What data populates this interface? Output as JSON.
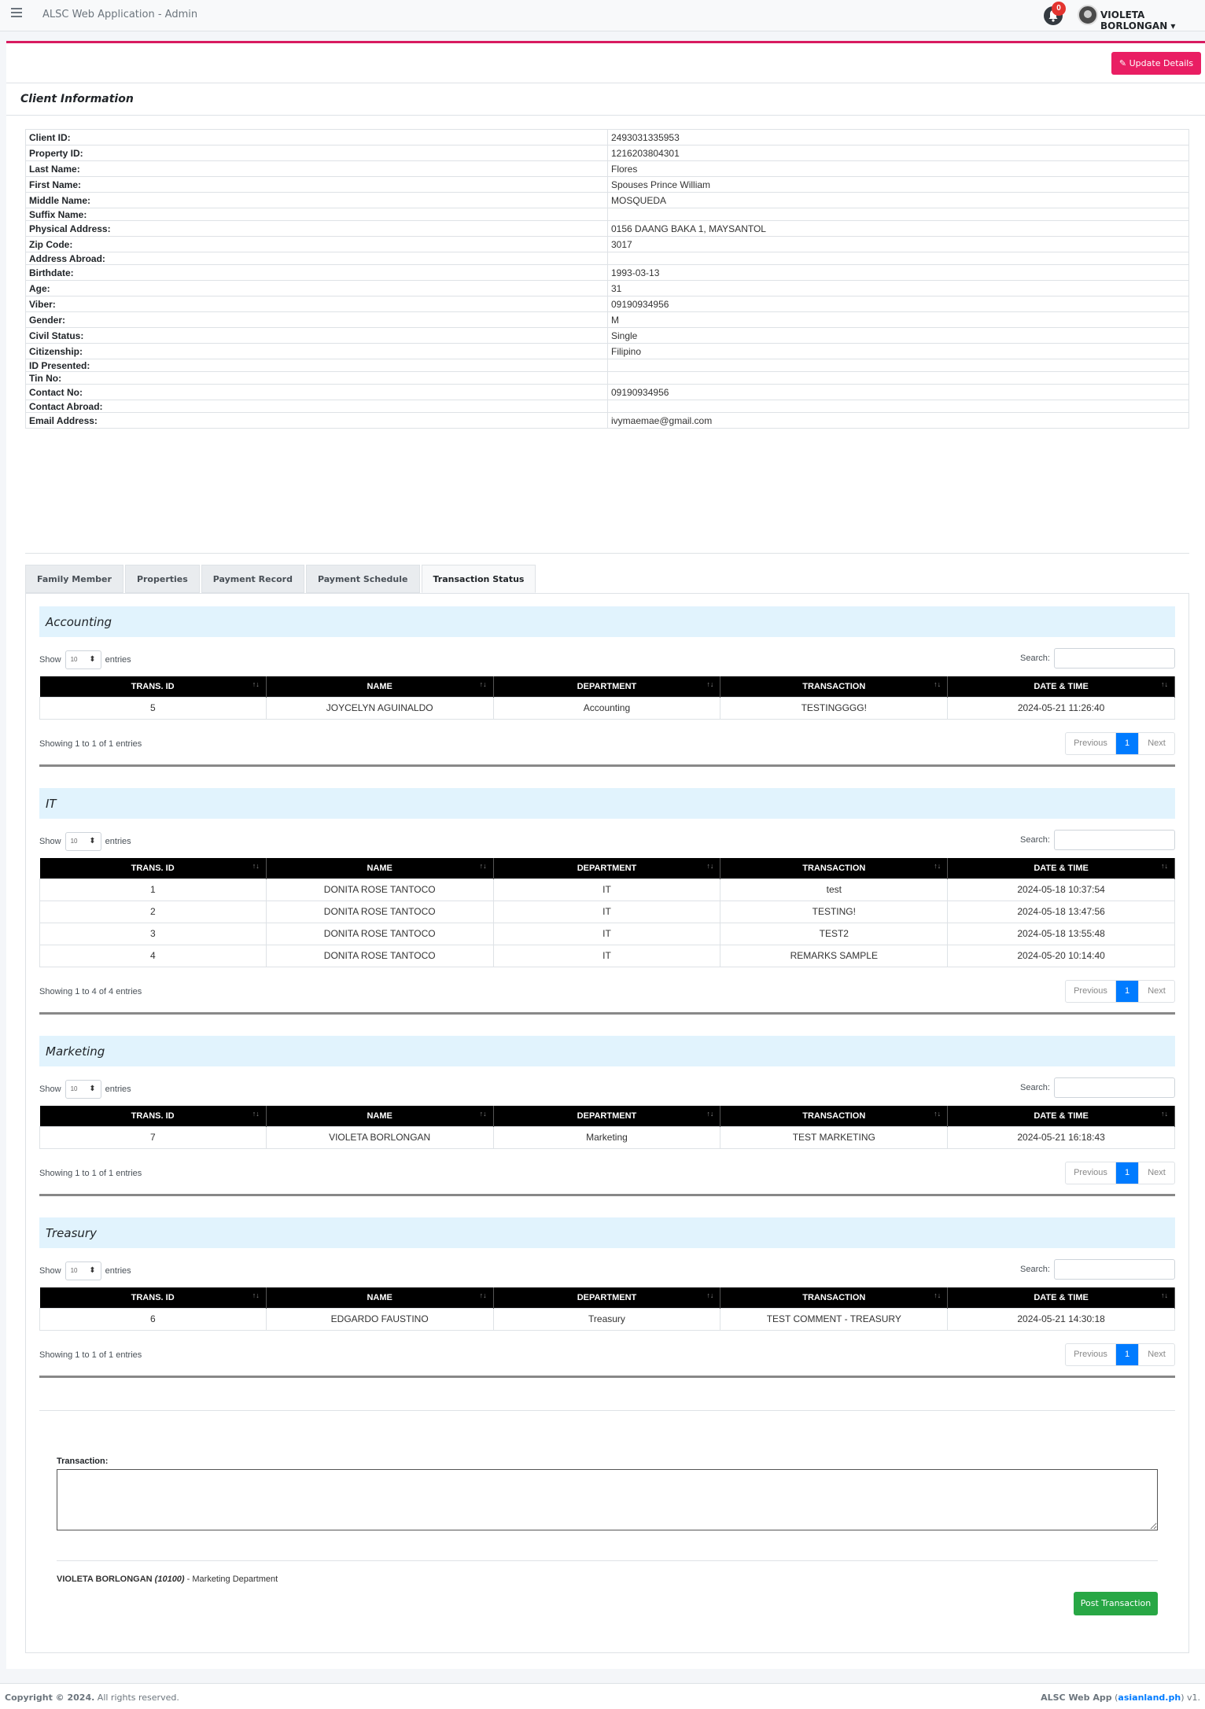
{
  "app": {
    "title": "ALSC Web Application - Admin"
  },
  "header": {
    "notification_count": "0",
    "user_name": "VIOLETA BORLONGAN ▾"
  },
  "actions": {
    "update_label": "Update Details"
  },
  "client": {
    "section_title": "Client Information",
    "rows": [
      {
        "label": "Client ID:",
        "value": "2493031335953"
      },
      {
        "label": "Property ID:",
        "value": "1216203804301"
      },
      {
        "label": "Last Name:",
        "value": "Flores"
      },
      {
        "label": "First Name:",
        "value": "Spouses Prince William"
      },
      {
        "label": "Middle Name:",
        "value": "MOSQUEDA"
      },
      {
        "label": "Suffix Name:",
        "value": ""
      },
      {
        "label": "Physical Address:",
        "value": "0156 DAANG BAKA 1, MAYSANTOL"
      },
      {
        "label": "Zip Code:",
        "value": "3017"
      },
      {
        "label": "Address Abroad:",
        "value": ""
      },
      {
        "label": "Birthdate:",
        "value": "1993-03-13"
      },
      {
        "label": "Age:",
        "value": "31"
      },
      {
        "label": "Viber:",
        "value": "09190934956"
      },
      {
        "label": "Gender:",
        "value": "M"
      },
      {
        "label": "Civil Status:",
        "value": "Single"
      },
      {
        "label": "Citizenship:",
        "value": "Filipino"
      },
      {
        "label": "ID Presented:",
        "value": ""
      },
      {
        "label": "Tin No:",
        "value": ""
      },
      {
        "label": "Contact No:",
        "value": "09190934956"
      },
      {
        "label": "Contact Abroad:",
        "value": ""
      },
      {
        "label": "Email Address:",
        "value": "ivymaemae@gmail.com"
      }
    ]
  },
  "tabs": [
    "Family Member",
    "Properties",
    "Payment Record",
    "Payment Schedule",
    "Transaction Status"
  ],
  "table_columns": [
    "TRANS. ID",
    "NAME",
    "DEPARTMENT",
    "TRANSACTION",
    "DATE & TIME"
  ],
  "controls": {
    "show": "Show",
    "entries_value": "10",
    "entries": "entries",
    "search": "Search:",
    "previous": "Previous",
    "page": "1",
    "next": "Next"
  },
  "departments": [
    {
      "name": "Accounting",
      "showing": "Showing 1 to 1 of 1 entries",
      "rows": [
        [
          "5",
          "JOYCELYN AGUINALDO",
          "Accounting",
          "TESTINGGGG!",
          "2024-05-21 11:26:40"
        ]
      ]
    },
    {
      "name": "IT",
      "showing": "Showing 1 to 4 of 4 entries",
      "rows": [
        [
          "1",
          "DONITA ROSE TANTOCO",
          "IT",
          "test",
          "2024-05-18 10:37:54"
        ],
        [
          "2",
          "DONITA ROSE TANTOCO",
          "IT",
          "TESTING!",
          "2024-05-18 13:47:56"
        ],
        [
          "3",
          "DONITA ROSE TANTOCO",
          "IT",
          "TEST2",
          "2024-05-18 13:55:48"
        ],
        [
          "4",
          "DONITA ROSE TANTOCO",
          "IT",
          "REMARKS SAMPLE",
          "2024-05-20 10:14:40"
        ]
      ]
    },
    {
      "name": "Marketing",
      "showing": "Showing 1 to 1 of 1 entries",
      "rows": [
        [
          "7",
          "VIOLETA BORLONGAN",
          "Marketing",
          "TEST MARKETING",
          "2024-05-21 16:18:43"
        ]
      ]
    },
    {
      "name": "Treasury",
      "showing": "Showing 1 to 1 of 1 entries",
      "rows": [
        [
          "6",
          "EDGARDO FAUSTINO",
          "Treasury",
          "TEST COMMENT - TREASURY",
          "2024-05-21 14:30:18"
        ]
      ]
    }
  ],
  "transaction_form": {
    "label": "Transaction:",
    "value": "",
    "poster_name": "VIOLETA BORLONGAN",
    "poster_id": "(10100)",
    "poster_dept": " - Marketing Department",
    "post_label": "Post Transaction"
  },
  "footer": {
    "copyright_bold": "Copyright © 2024.",
    "copyright_rest": " All rights reserved.",
    "app_bold": "ALSC Web App",
    "link_text": "asianland.ph",
    "version": "v1."
  }
}
